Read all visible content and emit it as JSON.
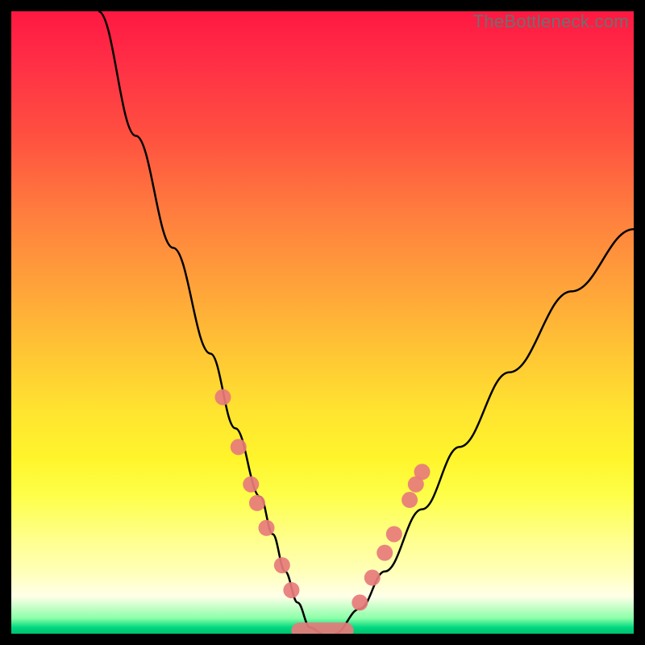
{
  "watermark": "TheBottleneck.com",
  "chart_data": {
    "type": "line",
    "title": "",
    "xlabel": "",
    "ylabel": "",
    "xlim": [
      0,
      100
    ],
    "ylim": [
      0,
      100
    ],
    "series": [
      {
        "name": "left-curve",
        "x": [
          14,
          20,
          26,
          32,
          36,
          40,
          42,
          44,
          46,
          48,
          50
        ],
        "y": [
          100,
          80,
          62,
          45,
          33,
          22,
          16,
          10,
          5,
          1,
          0
        ]
      },
      {
        "name": "right-curve",
        "x": [
          52,
          56,
          60,
          66,
          72,
          80,
          90,
          100
        ],
        "y": [
          0,
          4,
          10,
          20,
          30,
          42,
          55,
          65
        ]
      }
    ],
    "markers_left": [
      {
        "x": 34.0,
        "y": 38.0
      },
      {
        "x": 36.5,
        "y": 30.0
      },
      {
        "x": 38.5,
        "y": 24.0
      },
      {
        "x": 39.5,
        "y": 21.0
      },
      {
        "x": 41.0,
        "y": 17.0
      },
      {
        "x": 43.5,
        "y": 11.0
      },
      {
        "x": 45.0,
        "y": 7.0
      }
    ],
    "markers_right": [
      {
        "x": 56.0,
        "y": 5.0
      },
      {
        "x": 58.0,
        "y": 9.0
      },
      {
        "x": 60.0,
        "y": 13.0
      },
      {
        "x": 61.5,
        "y": 16.0
      },
      {
        "x": 64.0,
        "y": 21.5
      },
      {
        "x": 65.0,
        "y": 24.0
      },
      {
        "x": 66.0,
        "y": 26.0
      }
    ],
    "valley_bar": {
      "x1": 45.0,
      "x2": 55.0,
      "y": 0.5
    }
  }
}
